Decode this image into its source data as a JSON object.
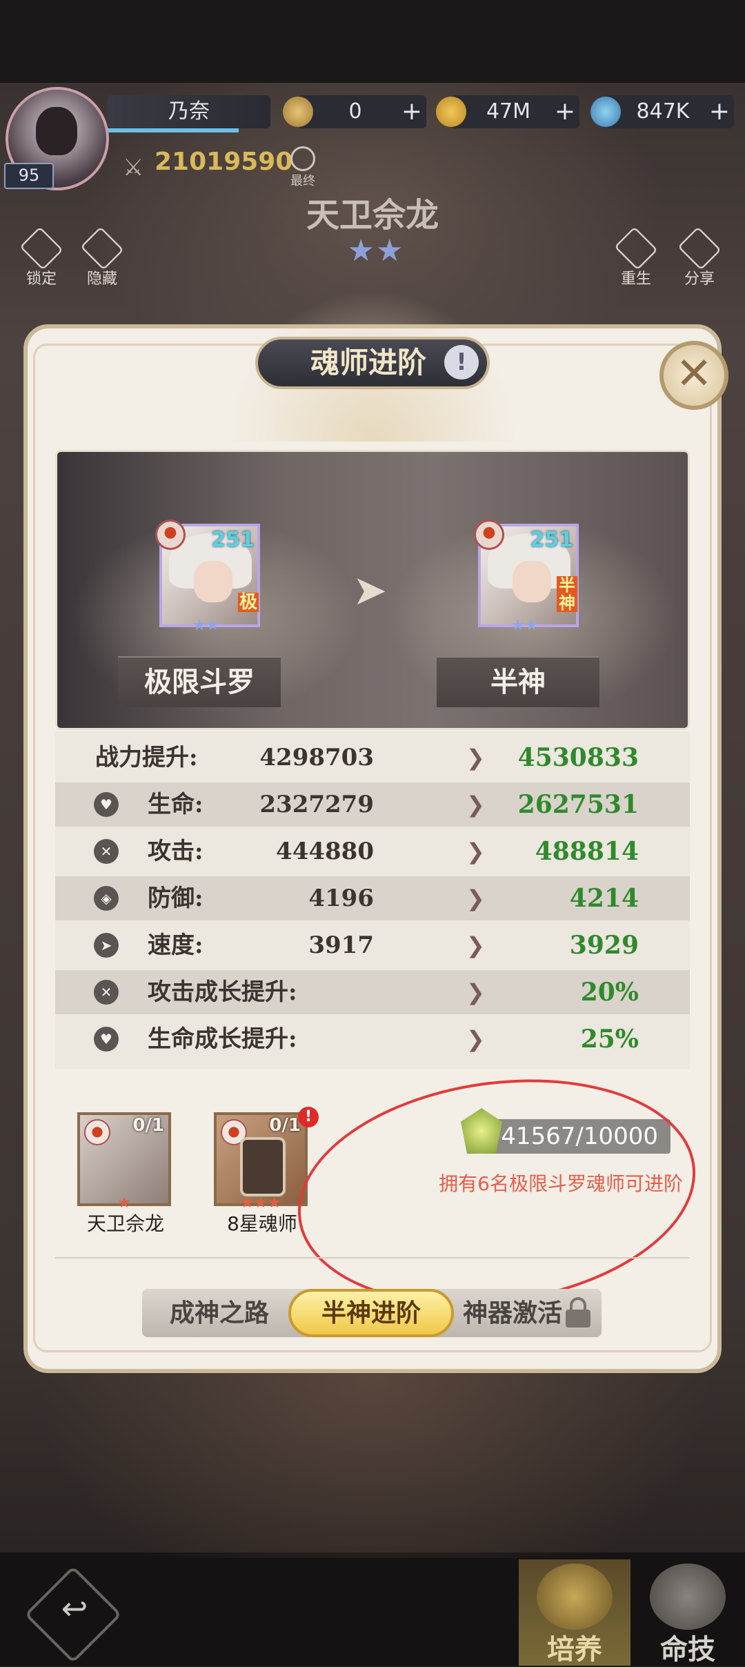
{
  "player": {
    "name": "乃奈",
    "level": "95",
    "power": "21019590",
    "final_label": "最终"
  },
  "currencies": [
    {
      "icon": "soul-coin-icon",
      "value": "0"
    },
    {
      "icon": "gold-coin-icon",
      "value": "47M"
    },
    {
      "icon": "potion-icon",
      "value": "847K"
    }
  ],
  "hero": {
    "name": "天卫佘龙",
    "stars": "★★"
  },
  "side_buttons": {
    "lock": "锁定",
    "hide": "隐藏",
    "rebirth": "重生",
    "share": "分享"
  },
  "panel": {
    "title": "魂师进阶",
    "info": "!",
    "close": "✕"
  },
  "advance": {
    "from": {
      "level": "251",
      "tag": "极",
      "rank": "极限斗罗"
    },
    "to": {
      "level": "251",
      "tag": "半神",
      "rank": "半神"
    }
  },
  "stats": [
    {
      "label": "战力提升:",
      "old": "4298703",
      "new": "4530833",
      "icon": ""
    },
    {
      "label": "生命:",
      "old": "2327279",
      "new": "2627531",
      "icon": "heart-icon"
    },
    {
      "label": "攻击:",
      "old": "444880",
      "new": "488814",
      "icon": "swords-icon"
    },
    {
      "label": "防御:",
      "old": "4196",
      "new": "4214",
      "icon": "shield-icon"
    },
    {
      "label": "速度:",
      "old": "3917",
      "new": "3929",
      "icon": "speed-icon"
    },
    {
      "label": "攻击成长提升:",
      "old": "",
      "new": "20%",
      "icon": "swords-icon"
    },
    {
      "label": "生命成长提升:",
      "old": "",
      "new": "25%",
      "icon": "heart-icon"
    }
  ],
  "materials": [
    {
      "name": "天卫佘龙",
      "count": "0/1",
      "stars": "★"
    },
    {
      "name": "8星魂师",
      "count": "0/1",
      "stars": "★★★",
      "notice": "!"
    }
  ],
  "cost": {
    "value": "41567/10000",
    "requirement": "拥有6名极限斗罗魂师可进阶"
  },
  "tabs": [
    {
      "label": "成神之路",
      "active": false
    },
    {
      "label": "半神进阶",
      "active": true
    },
    {
      "label": "神器激活",
      "active": false,
      "locked": true
    }
  ],
  "bottom_nav": {
    "back": "↩",
    "cultivate": "培养",
    "fate": "命技"
  },
  "colors": {
    "increase": "#2f8a2c",
    "requirement": "#e85c4a",
    "annotation": "#e23a3a"
  }
}
